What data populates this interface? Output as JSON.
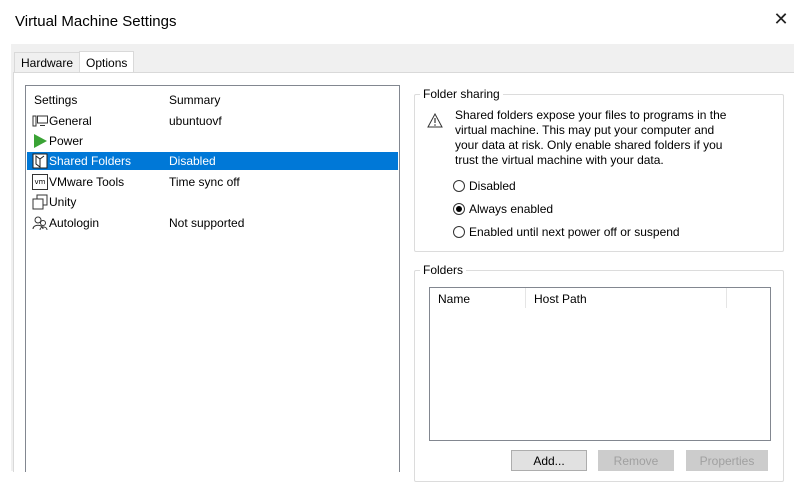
{
  "window": {
    "title": "Virtual Machine Settings",
    "close_glyph": "✕"
  },
  "tabs": [
    {
      "label": "Hardware"
    },
    {
      "label": "Options"
    }
  ],
  "settings_list": {
    "header_settings": "Settings",
    "header_summary": "Summary",
    "items": [
      {
        "name": "General",
        "summary": "ubuntuovf",
        "icon": "monitor-icon"
      },
      {
        "name": "Power",
        "summary": "",
        "icon": "play-icon"
      },
      {
        "name": "Shared Folders",
        "summary": "Disabled",
        "icon": "shared-folder-icon",
        "selected": true
      },
      {
        "name": "VMware Tools",
        "summary": "Time sync off",
        "icon": "vmware-icon",
        "icon_text": "vm"
      },
      {
        "name": "Unity",
        "summary": "",
        "icon": "windows-icon"
      },
      {
        "name": "Autologin",
        "summary": "Not supported",
        "icon": "users-icon"
      }
    ]
  },
  "folder_sharing": {
    "legend": "Folder sharing",
    "warning_lines": [
      "Shared folders expose your files to programs in the",
      "virtual machine. This may put your computer and",
      "your data at risk. Only enable shared folders if you",
      "trust the virtual machine with your data."
    ],
    "options": [
      {
        "label": "Disabled",
        "checked": false
      },
      {
        "label": "Always enabled",
        "checked": true
      },
      {
        "label": "Enabled until next power off or suspend",
        "checked": false
      }
    ]
  },
  "folders": {
    "legend": "Folders",
    "col_name": "Name",
    "col_host_path": "Host Path",
    "buttons": {
      "add": "Add...",
      "remove": "Remove",
      "properties": "Properties"
    }
  },
  "colors": {
    "selection": "#0078d7",
    "power_icon": "#3aa335"
  }
}
